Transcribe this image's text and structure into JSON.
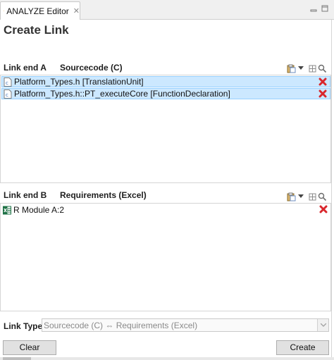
{
  "tab": {
    "label": "ANALYZE Editor",
    "close": "✕"
  },
  "title": "Create Link",
  "link_end_a": {
    "label": "Link end A",
    "type": "Sourcecode (C)",
    "items": [
      {
        "text": "Platform_Types.h [TranslationUnit]",
        "icon": "c-file-icon"
      },
      {
        "text": "Platform_Types.h::PT_executeCore [FunctionDeclaration]",
        "icon": "c-file-icon"
      }
    ]
  },
  "link_end_b": {
    "label": "Link end B",
    "type": "Requirements (Excel)",
    "items": [
      {
        "text": "R Module A:2",
        "icon": "excel-icon"
      }
    ]
  },
  "link_type": {
    "label": "Link Type",
    "value": "Sourcecode (C) ⇔ Requirements (Excel)"
  },
  "buttons": {
    "clear": "Clear",
    "create": "Create"
  },
  "colors": {
    "selection": "#cce8ff",
    "selection_border": "#99d1ff",
    "delete": "#d9262c",
    "excel": "#1e7145"
  }
}
